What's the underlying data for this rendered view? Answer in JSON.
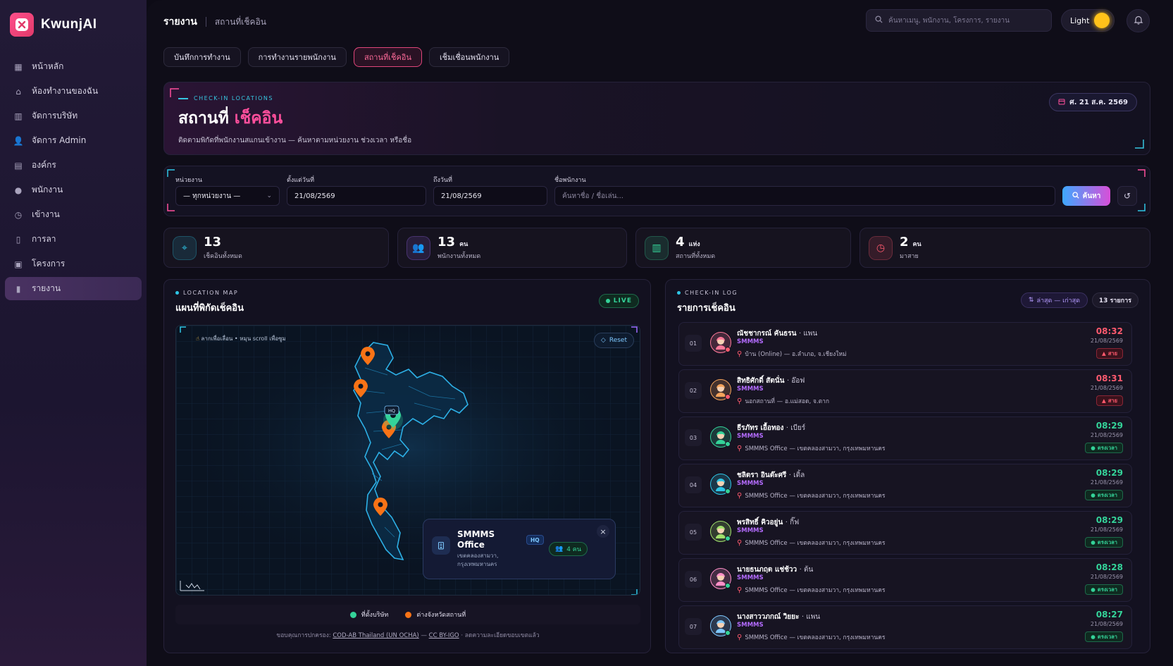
{
  "app": {
    "name": "KwunjAI"
  },
  "sidebar": {
    "items": [
      {
        "label": "หน้าหลัก",
        "icon": "dashboard-icon"
      },
      {
        "label": "ห้องทำงานของฉัน",
        "icon": "home-icon"
      },
      {
        "label": "จัดการบริษัท",
        "icon": "building-icon"
      },
      {
        "label": "จัดการ Admin",
        "icon": "admin-icon"
      },
      {
        "label": "องค์กร",
        "icon": "org-icon"
      },
      {
        "label": "พนักงาน",
        "icon": "user-icon"
      },
      {
        "label": "เข้างาน",
        "icon": "clock-icon"
      },
      {
        "label": "การลา",
        "icon": "document-icon"
      },
      {
        "label": "โครงการ",
        "icon": "project-icon"
      },
      {
        "label": "รายงาน",
        "icon": "report-icon",
        "active": true
      }
    ]
  },
  "header": {
    "title": "รายงาน",
    "breadcrumb": "สถานที่เช็คอิน",
    "search_placeholder": "ค้นหาเมนู, พนักงาน, โครงการ, รายงาน",
    "theme_label": "Light"
  },
  "tabs": [
    {
      "label": "บันทึกการทำงาน"
    },
    {
      "label": "การทำงานรายพนักงาน"
    },
    {
      "label": "สถานที่เช็คอิน",
      "active": true
    },
    {
      "label": "เช็มเชื่อนพนักงาน"
    }
  ],
  "hero": {
    "tag": "CHECK-IN LOCATIONS",
    "title_plain": "สถานที่",
    "title_accent": "เช็คอิน",
    "description": "ติดตามพิกัดที่พนักงานสแกนเข้างาน — ค้นหาตามหน่วยงาน ช่วงเวลา หรือชื่อ",
    "date": "ศ. 21 ส.ค. 2569"
  },
  "filters": {
    "department_label": "หน่วยงาน",
    "department_value": "— ทุกหน่วยงาน —",
    "from_label": "ตั้งแต่วันที่",
    "from_value": "21/08/2569",
    "to_label": "ถึงวันที่",
    "to_value": "21/08/2569",
    "name_label": "ชื่อพนักงาน",
    "name_placeholder": "ค้นหาชื่อ / ชื่อเล่น...",
    "search_button": "ค้นหา"
  },
  "stats": [
    {
      "value": "13",
      "unit": "",
      "label": "เช็คอินทั้งหมด",
      "color": "#2ec6e6"
    },
    {
      "value": "13",
      "unit": "คน",
      "label": "พนักงานทั้งหมด",
      "color": "#a06bff"
    },
    {
      "value": "4",
      "unit": "แห่ง",
      "label": "สถานที่ทั้งหมด",
      "color": "#34d399"
    },
    {
      "value": "2",
      "unit": "คน",
      "label": "มาสาย",
      "color": "#ff5a6e"
    }
  ],
  "map_panel": {
    "tag": "LOCATION MAP",
    "title": "แผนที่พิกัดเช็คอิน",
    "live": "LIVE",
    "hint": "ลากเพื่อเลื่อน • หมุน scroll เพื่อซูม",
    "reset": "Reset",
    "hq_label": "HQ",
    "popup": {
      "name": "SMMMS Office",
      "badge": "HQ",
      "address": "เขตคลองสามวา, กรุงเทพมหานคร",
      "count": "4 คน"
    },
    "legend": [
      {
        "label": "ที่ตั้งบริษัท",
        "color": "#34d399"
      },
      {
        "label": "ต่างจังหวัดสถานที่",
        "color": "#f97316"
      }
    ],
    "attribution_prefix": "ขอบคุณการปกครอง:",
    "attribution_link1": "COD-AB Thailand (UN OCHA)",
    "attribution_sep": "—",
    "attribution_link2": "CC BY-IGO",
    "attribution_suffix": "· ลดความละเอียดขอบเขตแล้ว"
  },
  "log_panel": {
    "tag": "CHECK-IN LOG",
    "title": "รายการเช็คอิน",
    "sort_label": "ล่าสุด — เก่าสุด",
    "count_label": "13 รายการ",
    "items": [
      {
        "num": "01",
        "name": "ณัชชากรณ์ คันธรน",
        "nick": "· แพน",
        "org": "SMMMS",
        "location": "บ้าน (Online) — อ.ลำเภอ, จ.เชียงใหม่",
        "time": "08:32",
        "date": "21/08/2569",
        "status": "สาย",
        "late": true
      },
      {
        "num": "02",
        "name": "สิทธิศักดิ์ สัตนั่น",
        "nick": "· อ๊อฟ",
        "org": "SMMMS",
        "location": "นอกสถานที่ — อ.แม่สอด, จ.ตาก",
        "time": "08:31",
        "date": "21/08/2569",
        "status": "สาย",
        "late": true
      },
      {
        "num": "03",
        "name": "ธีรภัทร เอื้อทอง",
        "nick": "· เบียร์",
        "org": "SMMMS",
        "location": "SMMMS Office — เขตคลองสามวา, กรุงเทพมหานคร",
        "time": "08:29",
        "date": "21/08/2569",
        "status": "ตรงเวลา",
        "late": false
      },
      {
        "num": "04",
        "name": "ชลิตรา อินต๊ะศรี",
        "nick": "· เติ้ล",
        "org": "SMMMS",
        "location": "SMMMS Office — เขตคลองสามวา, กรุงเทพมหานคร",
        "time": "08:29",
        "date": "21/08/2569",
        "status": "ตรงเวลา",
        "late": false
      },
      {
        "num": "05",
        "name": "พรสิทธิ์ คิวอยู่น",
        "nick": "· กิ๊ฟ",
        "org": "SMMMS",
        "location": "SMMMS Office — เขตคลองสามวา, กรุงเทพมหานคร",
        "time": "08:29",
        "date": "21/08/2569",
        "status": "ตรงเวลา",
        "late": false
      },
      {
        "num": "06",
        "name": "นายธนภฤต แช่ช้วว",
        "nick": "· ต้น",
        "org": "SMMMS",
        "location": "SMMMS Office — เขตคลองสามวา, กรุงเทพมหานคร",
        "time": "08:28",
        "date": "21/08/2569",
        "status": "ตรงเวลา",
        "late": false
      },
      {
        "num": "07",
        "name": "นางสาววภกณ์ วิยยะ",
        "nick": "· แพน",
        "org": "SMMMS",
        "location": "SMMMS Office — เขตคลองสามวา, กรุงเทพมหานคร",
        "time": "08:27",
        "date": "21/08/2569",
        "status": "ตรงเวลา",
        "late": false
      }
    ]
  },
  "colors": {
    "accent": "#ff4f9c",
    "late": "#ff5a6e",
    "ok": "#34d399",
    "cyan": "#2ec6e6",
    "purple": "#a06bff"
  }
}
